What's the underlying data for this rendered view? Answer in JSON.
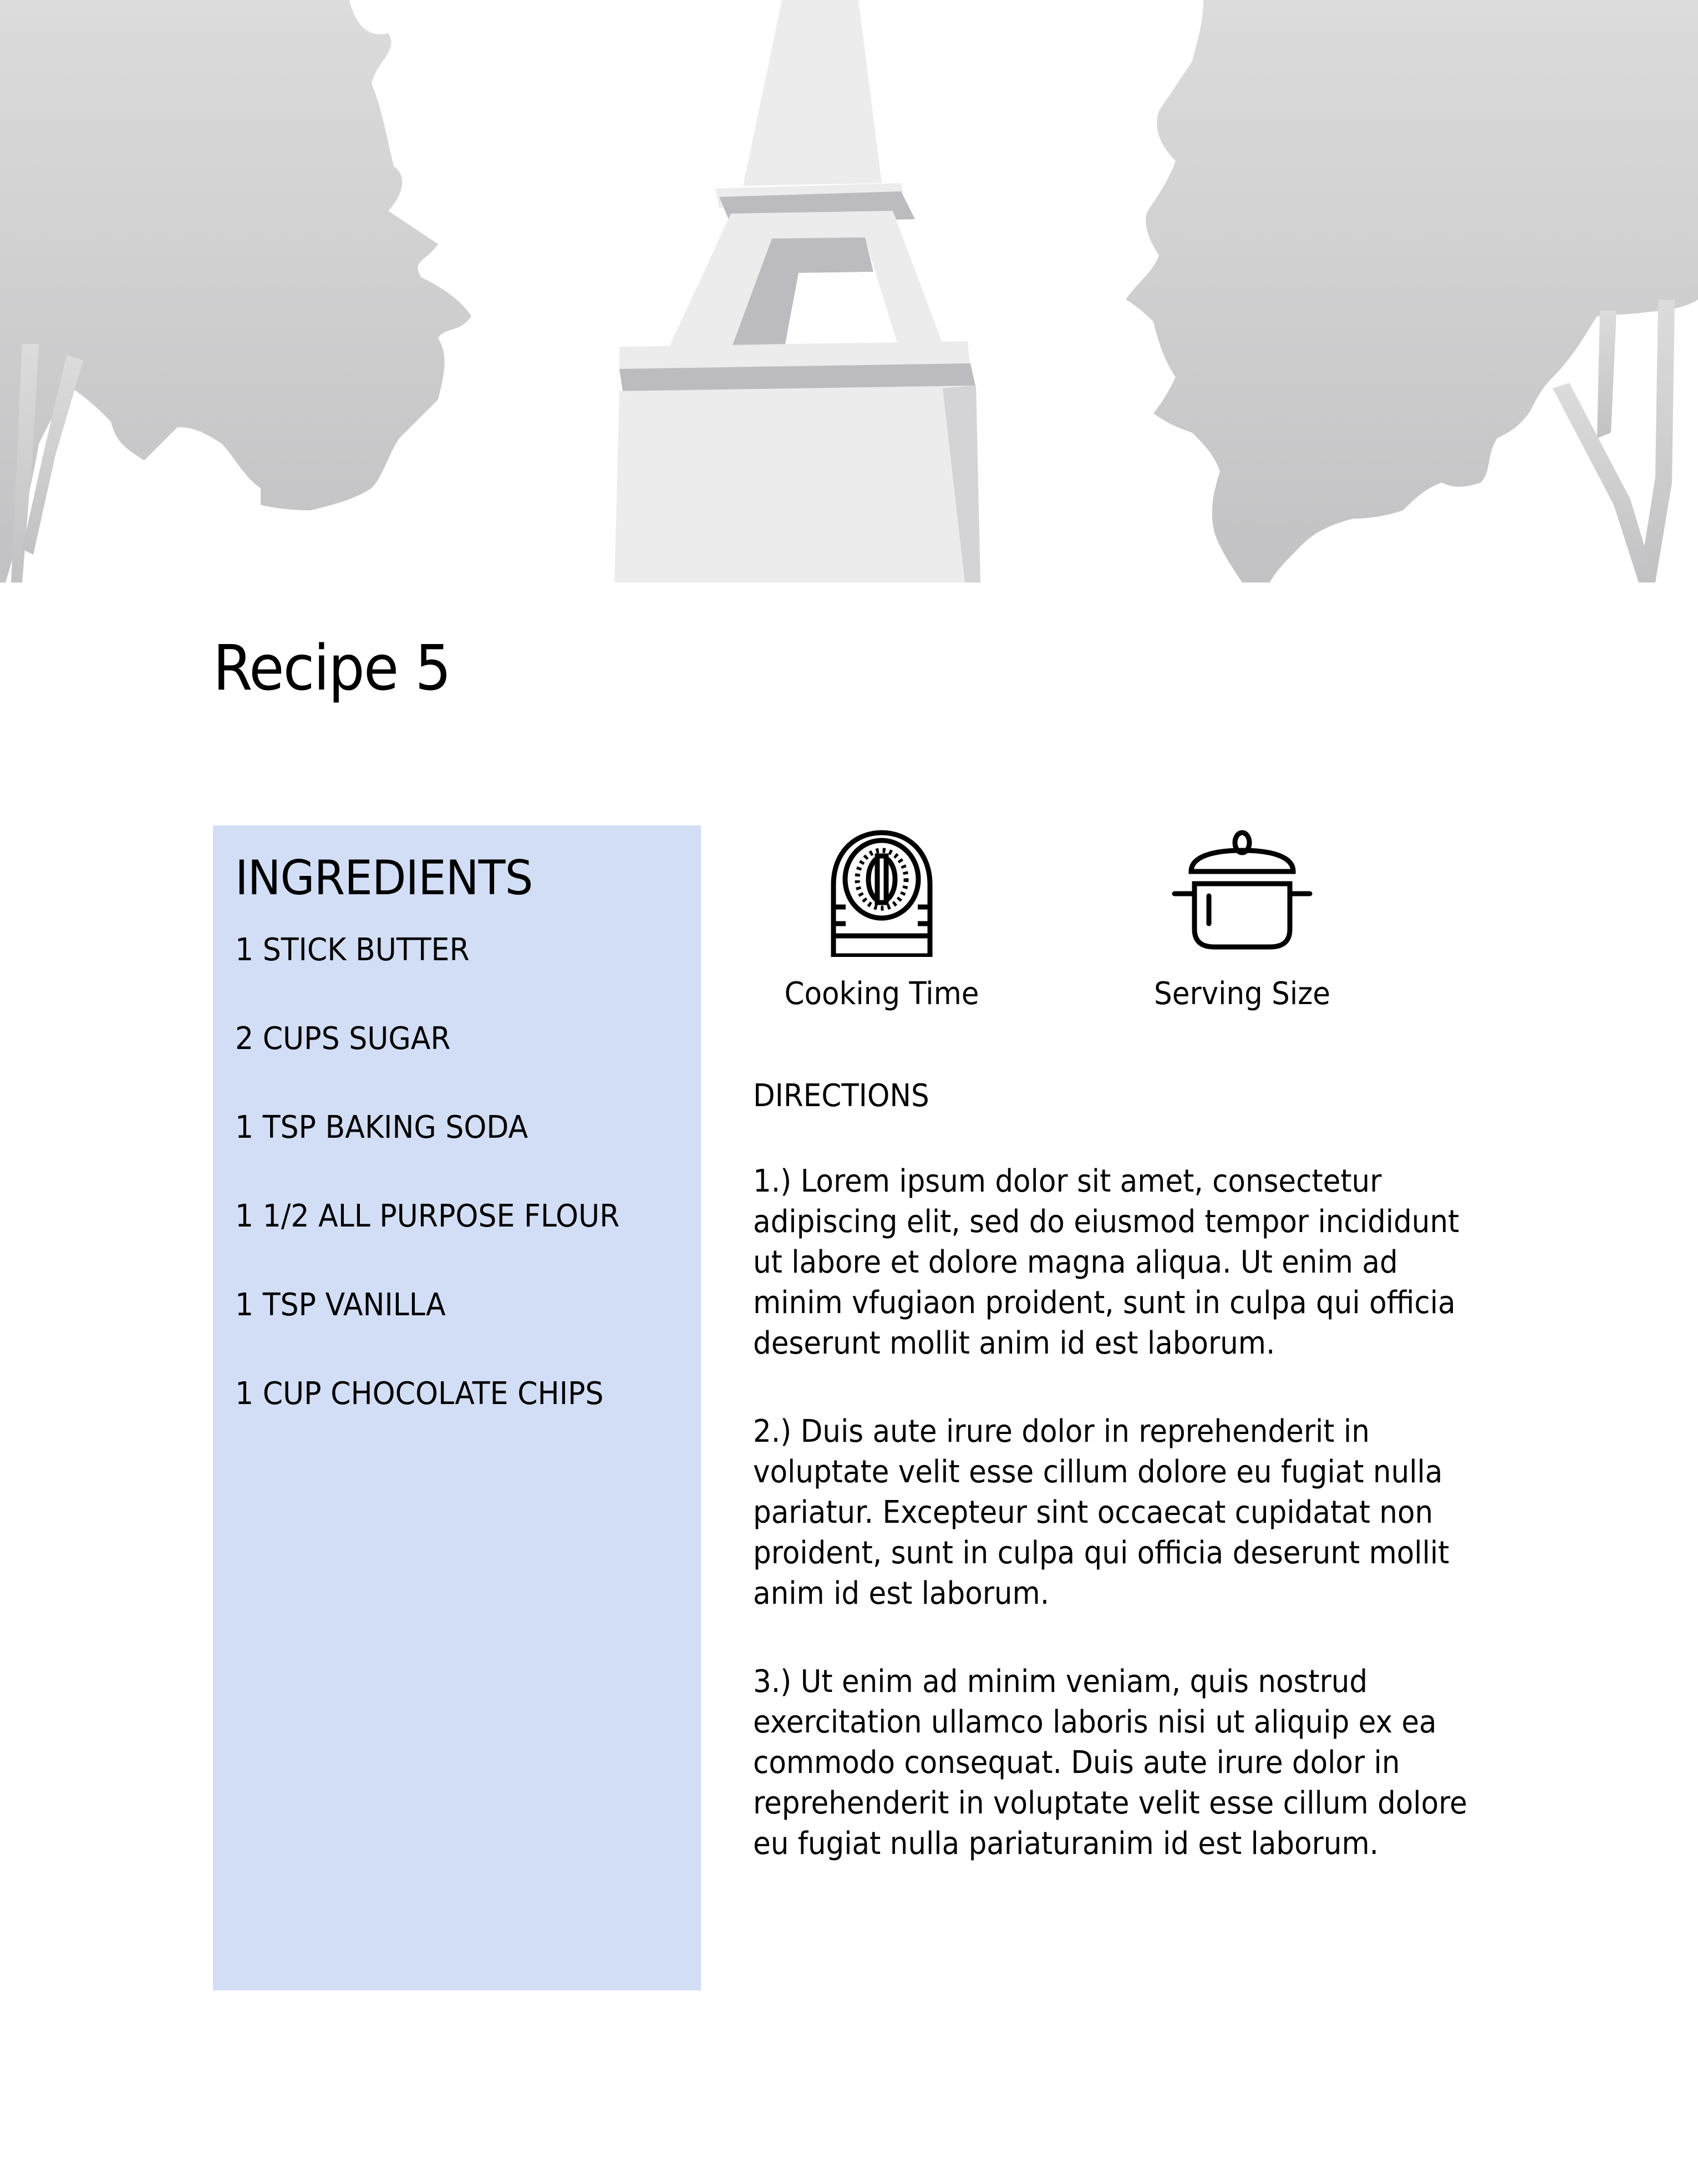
{
  "page": {
    "title": "Recipe 5"
  },
  "hero": {
    "description": "Header illustration: Eiffel Tower base flanked by two trees",
    "colors": {
      "tree_top": "#dcdcdc",
      "tree_bottom": "#c4c4c6",
      "tower_light": "#ececec",
      "tower_shadow": "#bcbcc0"
    }
  },
  "ingredients": {
    "heading": "INGREDIENTS",
    "background": "#d2def5",
    "items": [
      "1 STICK BUTTER",
      "2 CUPS SUGAR",
      "1 TSP BAKING SODA",
      "1 1/2 ALL PURPOSE FLOUR",
      "1 TSP VANILLA",
      "1 CUP CHOCOLATE CHIPS"
    ]
  },
  "info": {
    "cooking_time": {
      "icon": "kitchen-timer-icon",
      "label": "Cooking Time"
    },
    "serving_size": {
      "icon": "cooking-pot-icon",
      "label": "Serving Size"
    }
  },
  "directions": {
    "heading": "DIRECTIONS",
    "steps": [
      "1.) Lorem ipsum dolor sit amet, consectetur adipiscing elit, sed do eiusmod tempor incididunt ut labore et dolore magna aliqua. Ut enim ad minim vfugiaon proident, sunt in culpa qui officia deserunt mollit anim id est laborum.",
      "2.) Duis aute irure dolor in reprehenderit in voluptate velit esse cillum dolore eu fugiat nulla pariatur. Excepteur sint occaecat cupidatat non proident, sunt in culpa qui officia deserunt mollit anim id est laborum.",
      "3.) Ut enim ad minim veniam, quis nostrud exercitation ullamco laboris nisi ut aliquip ex ea commodo consequat. Duis aute irure dolor in reprehenderit in voluptate velit esse cillum dolore eu fugiat nulla pariaturanim id est laborum."
    ]
  }
}
